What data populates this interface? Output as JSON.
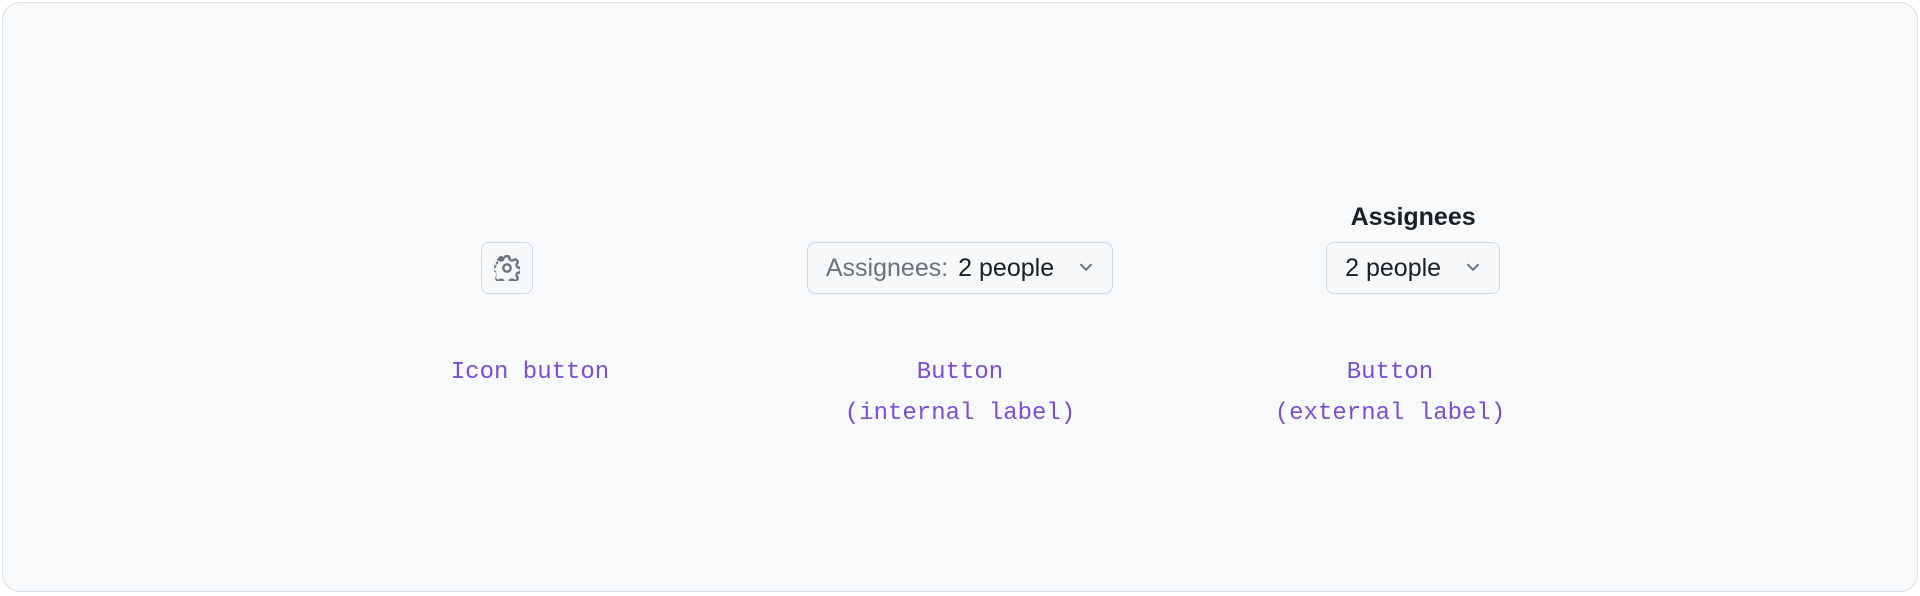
{
  "examples": {
    "iconButton": {
      "caption": "Icon button"
    },
    "internal": {
      "prefix": "Assignees:",
      "value": "2 people",
      "caption": "Button\n(internal label)"
    },
    "external": {
      "label": "Assignees",
      "value": "2 people",
      "caption": "Button\n(external label)"
    }
  },
  "colors": {
    "caption": "#7a4fd3",
    "panel": "#f7f9fb",
    "border": "#d2d8de"
  }
}
